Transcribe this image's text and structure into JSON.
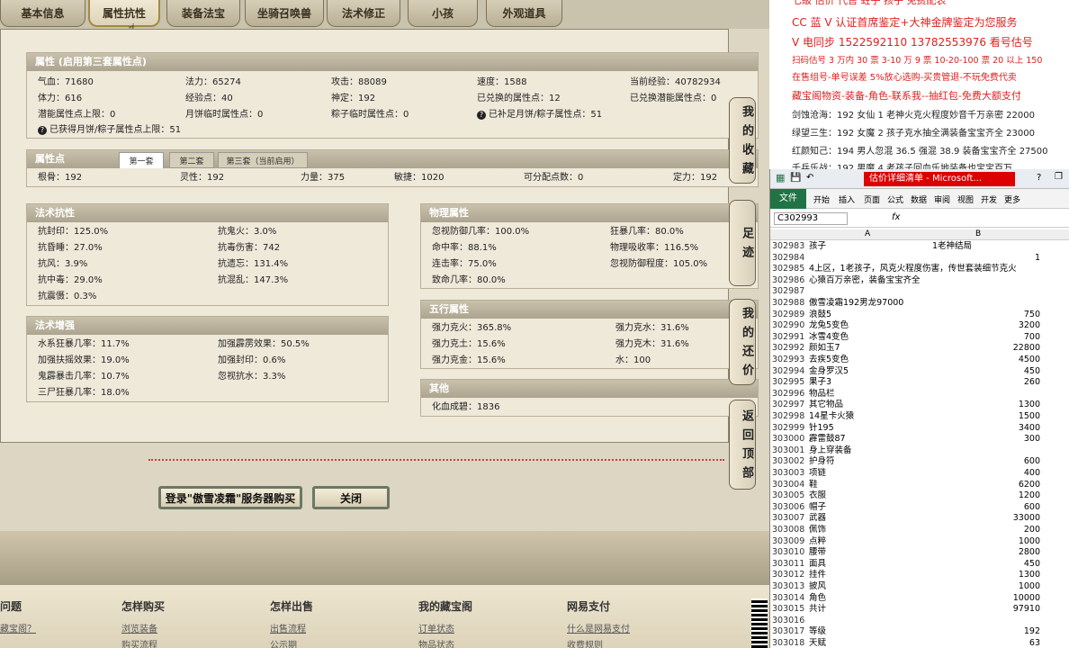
{
  "tabs": [
    "基本信息",
    "属性抗性",
    "装备法宝",
    "坐骑召唤兽",
    "法术修正",
    "小孩",
    "外观道具"
  ],
  "attr_section": {
    "title": "属性 (启用第三套属性点)",
    "row1": [
      "气血：71680",
      "法力：65274",
      "攻击：88089",
      "速度：1588",
      "当前经验：40782934"
    ],
    "row2": [
      "体力：616",
      "经验点：40",
      "神定：192",
      "已兑换的属性点：12",
      "已兑换潜能属性点：0"
    ],
    "row3": [
      "潜能属性点上限：0",
      "月饼临时属性点：0",
      "粽子临时属性点：0",
      "已补足月饼/粽子属性点：51"
    ],
    "row4": "已获得月饼/粽子属性点上限：51"
  },
  "points_section": {
    "title": "属性点",
    "subtabs": [
      "第一套",
      "第二套",
      "第三套（当前启用）"
    ],
    "values": [
      "根骨：192",
      "灵性：192",
      "力量：375",
      "敏捷：1020",
      "可分配点数：0",
      "定力：192"
    ]
  },
  "resist": {
    "title": "法术抗性",
    "left": [
      "抗封印：125.0%",
      "抗昏睡：27.0%",
      "抗风：3.9%",
      "抗中毒：29.0%",
      "抗震慑：0.3%"
    ],
    "right": [
      "抗鬼火：3.0%",
      "抗毒伤害：742",
      "抗遗忘：131.4%",
      "抗混乱：147.3%"
    ]
  },
  "physical": {
    "title": "物理属性",
    "left": [
      "忽视防御几率：100.0%",
      "命中率：88.1%",
      "连击率：75.0%",
      "致命几率：80.0%"
    ],
    "right": [
      "狂暴几率：80.0%",
      "物理吸收率：116.5%",
      "忽视防御程度：105.0%"
    ]
  },
  "enhance": {
    "title": "法术增强",
    "left": [
      "水系狂暴几率：11.7%",
      "加强扶摇效果：19.0%",
      "鬼霹暴击几率：10.7%",
      "三尸狂暴几率：18.0%"
    ],
    "right": [
      "加强霹雳效果：50.5%",
      "加强封印：0.6%",
      "忽视抗水：3.3%"
    ]
  },
  "wuxing": {
    "title": "五行属性",
    "left": [
      "强力克火：365.8%",
      "强力克土：15.6%",
      "强力克金：15.6%"
    ],
    "right": [
      "强力克水：31.6%",
      "强力克木：31.6%",
      "水：100"
    ]
  },
  "other": {
    "title": "其他",
    "values": [
      "化血成碧：1836"
    ]
  },
  "side_buttons": [
    "我的收藏",
    "足迹",
    "我的还价",
    "返回顶部"
  ],
  "buttons": {
    "login": "登录\"傲雪凌霜\"服务器购买",
    "close": "关闭"
  },
  "footer": [
    {
      "h": "问题",
      "l": [
        "藏宝阁？"
      ]
    },
    {
      "h": "怎样购买",
      "l": [
        "浏览装备",
        "购买流程"
      ]
    },
    {
      "h": "怎样出售",
      "l": [
        "出售流程",
        "公示期"
      ]
    },
    {
      "h": "我的藏宝阁",
      "l": [
        "订单状态",
        "物品状态"
      ]
    },
    {
      "h": "网易支付",
      "l": [
        "什么是网易支付",
        "收费规则"
      ]
    }
  ],
  "right_text": [
    {
      "t": "七級 估价 代售 蛀子 孩子 免费配表",
      "c": "#e02020"
    },
    {
      "t": "CC 蓝 V 认证首席鉴定+大神金牌鉴定为您服务",
      "c": "#e02020"
    },
    {
      "t": "V 电同步 1522592110  13782553976 看号估号",
      "c": "#e02020"
    },
    {
      "t": "扫码估号 3 万内 30 票 3-10 万 9 票  10-20-100 票 20 以上 150",
      "c": "#e02020"
    },
    {
      "t": "在售组号-单号误差 5%放心选购-买贵管退-不玩免费代卖",
      "c": "#e02020"
    },
    {
      "t": "藏宝阁物资-装备-角色-联系我--抽红包-免费大额支付",
      "c": "#e02020"
    },
    {
      "t": "剑蚀沧海：192 女仙 1 老神火克火程度妙音千万亲密 22000",
      "c": "#222"
    },
    {
      "t": "绿望三生：192 女魔 2 孩子克水抽全满装备宝宝齐全 23000",
      "c": "#222"
    },
    {
      "t": "红颜知己：194 男人忽混 36.5 强混 38.9 装备宝宝齐全 27500",
      "c": "#222"
    },
    {
      "t": "千兵乐战：192 男魔 4 老孩子回血乐地装备也宝宝百万",
      "c": "#222"
    }
  ],
  "excel": {
    "title": "估价详细清单 - Microsoft...",
    "ribbon": [
      "文件",
      "开始",
      "插入",
      "页面",
      "公式",
      "数据",
      "审阅",
      "视图",
      "开发",
      "更多"
    ],
    "namebox": "C302993",
    "fx": "fx",
    "cols": [
      "A",
      "B"
    ],
    "rows": [
      [
        "302983",
        "孩子",
        "1老神结局"
      ],
      [
        "302984",
        "",
        "1"
      ],
      [
        "302985",
        "4上区，1老孩子，风克火程度伤害，传世套装细节克火",
        ""
      ],
      [
        "302986",
        "心猿百万亲密，装备宝宝齐全",
        ""
      ],
      [
        "302987",
        "",
        ""
      ],
      [
        "302988",
        "傲雪凌霜192男龙97000",
        ""
      ],
      [
        "302989",
        "浪鼓5",
        "750"
      ],
      [
        "302990",
        "龙兔5变色",
        "3200"
      ],
      [
        "302991",
        "冰雪4变色",
        "700"
      ],
      [
        "302992",
        "颜如玉7",
        "22800"
      ],
      [
        "302993",
        "去疾5变色",
        "4500"
      ],
      [
        "302994",
        "金身罗汉5",
        "450"
      ],
      [
        "302995",
        "果子3",
        "260"
      ],
      [
        "302996",
        "物品栏",
        ""
      ],
      [
        "302997",
        "其它物品",
        "1300"
      ],
      [
        "302998",
        "14星卡火猿",
        "1500"
      ],
      [
        "302999",
        "针195",
        "3400"
      ],
      [
        "303000",
        "霹雷鼓87",
        "300"
      ],
      [
        "303001",
        "身上穿装备",
        ""
      ],
      [
        "303002",
        "护身符",
        "600"
      ],
      [
        "303003",
        "项链",
        "400"
      ],
      [
        "303004",
        "鞋",
        "6200"
      ],
      [
        "303005",
        "衣服",
        "1200"
      ],
      [
        "303006",
        "帽子",
        "600"
      ],
      [
        "303007",
        "武器",
        "33000"
      ],
      [
        "303008",
        "佩饰",
        "200"
      ],
      [
        "303009",
        "点粹",
        "1000"
      ],
      [
        "303010",
        "腰带",
        "2800"
      ],
      [
        "303011",
        "面具",
        "450"
      ],
      [
        "303012",
        "挂件",
        "1300"
      ],
      [
        "303013",
        "披风",
        "1000"
      ],
      [
        "303014",
        "角色",
        "10000"
      ],
      [
        "303015",
        "共计",
        "97910"
      ],
      [
        "303016",
        "",
        ""
      ],
      [
        "303017",
        "等级",
        "192"
      ],
      [
        "303018",
        "天赋",
        "63"
      ]
    ]
  }
}
